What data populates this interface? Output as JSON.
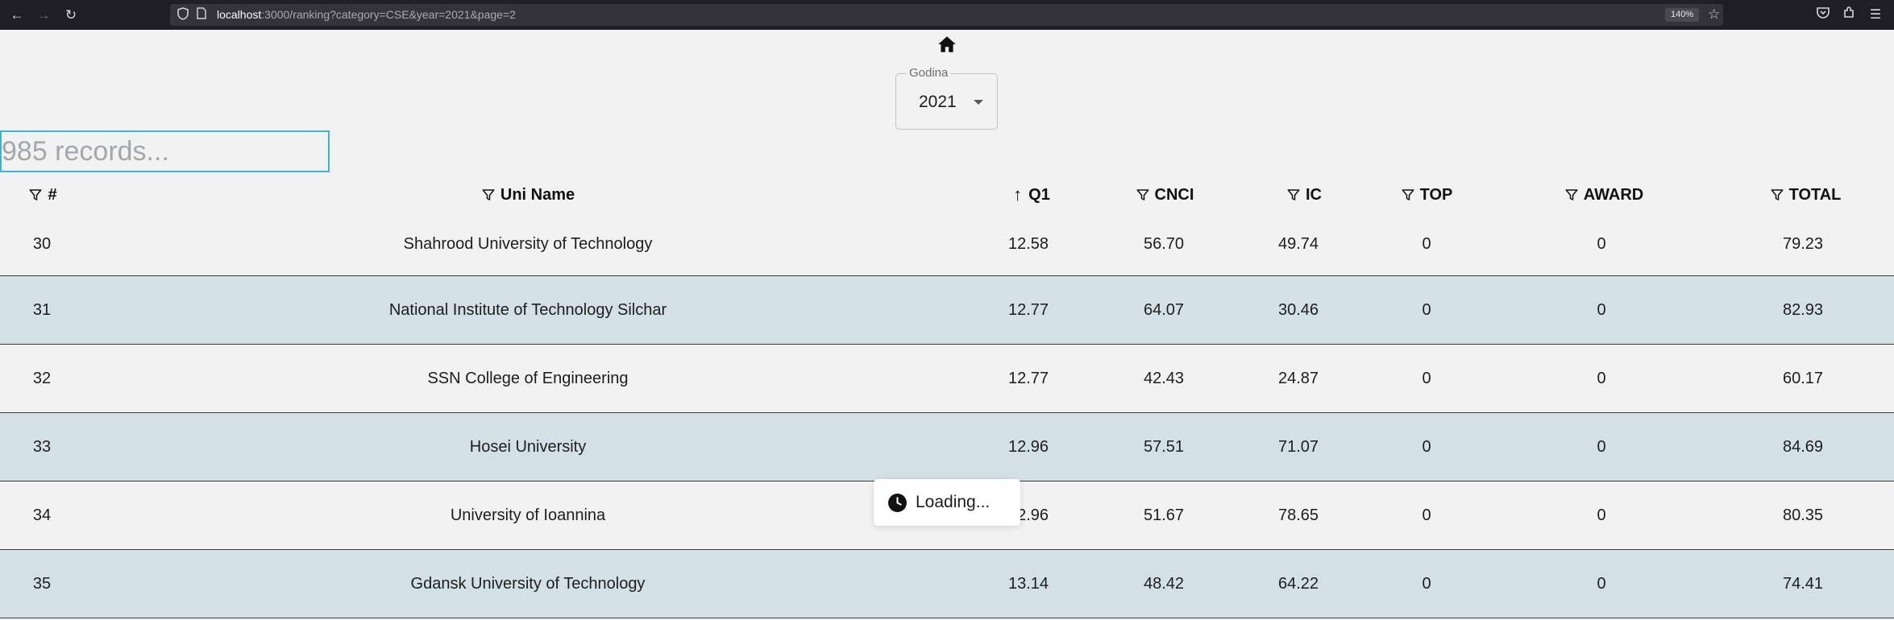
{
  "browser": {
    "url_host": "localhost",
    "url_rest": ":3000/ranking?category=CSE&year=2021&page=2",
    "zoom": "140%"
  },
  "year_select": {
    "label": "Godina",
    "value": "2021"
  },
  "search": {
    "placeholder": "985 records..."
  },
  "table": {
    "headers": {
      "rank": "#",
      "name": "Uni Name",
      "q1": "Q1",
      "cnci": "CNCI",
      "ic": "IC",
      "top": "TOP",
      "award": "AWARD",
      "total": "TOTAL"
    },
    "sort_column": "q1",
    "sort_direction": "ascending",
    "rows": [
      {
        "rank": "30",
        "name": "Shahrood University of Technology",
        "q1": "12.58",
        "cnci": "56.70",
        "ic": "49.74",
        "top": "0",
        "award": "0",
        "total": "79.23"
      },
      {
        "rank": "31",
        "name": "National Institute of Technology Silchar",
        "q1": "12.77",
        "cnci": "64.07",
        "ic": "30.46",
        "top": "0",
        "award": "0",
        "total": "82.93"
      },
      {
        "rank": "32",
        "name": "SSN College of Engineering",
        "q1": "12.77",
        "cnci": "42.43",
        "ic": "24.87",
        "top": "0",
        "award": "0",
        "total": "60.17"
      },
      {
        "rank": "33",
        "name": "Hosei University",
        "q1": "12.96",
        "cnci": "57.51",
        "ic": "71.07",
        "top": "0",
        "award": "0",
        "total": "84.69"
      },
      {
        "rank": "34",
        "name": "University of Ioannina",
        "q1": "12.96",
        "cnci": "51.67",
        "ic": "78.65",
        "top": "0",
        "award": "0",
        "total": "80.35"
      },
      {
        "rank": "35",
        "name": "Gdansk University of Technology",
        "q1": "13.14",
        "cnci": "48.42",
        "ic": "64.22",
        "top": "0",
        "award": "0",
        "total": "74.41"
      }
    ]
  },
  "loading": {
    "text": "Loading..."
  },
  "colors": {
    "accent_border": "#38b6d6",
    "alt_row": "#d3e0e6",
    "page_bg": "#f2f2f2"
  }
}
